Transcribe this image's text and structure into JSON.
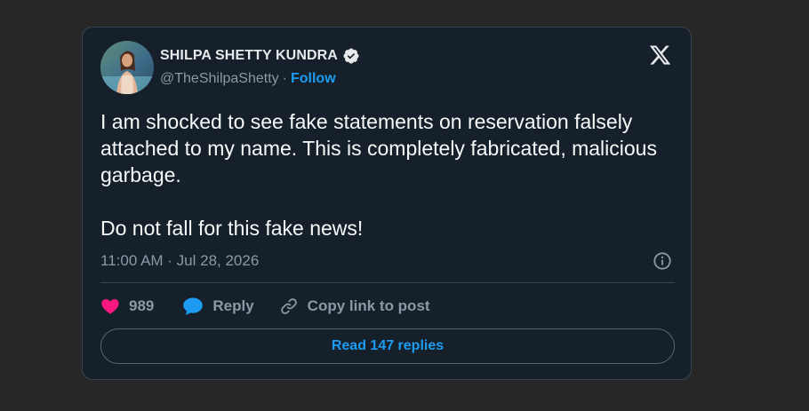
{
  "tweet": {
    "author_name": "SHILPA SHETTY KUNDRA",
    "handle": "@TheShilpaShetty",
    "separator": "·",
    "follow_label": "Follow",
    "paragraphs": [
      "I am shocked to see fake statements on reservation falsely attached to my name. This is completely fabricated, malicious garbage.",
      "Do not fall for this fake news!"
    ],
    "timestamp": "11:00 AM · Jul 28, 2026",
    "likes": "989",
    "reply_label": "Reply",
    "copy_link_label": "Copy link to post",
    "read_replies_label": "Read 147 replies"
  },
  "colors": {
    "page_background": "#272727",
    "card_background": "#15202b",
    "border": "#38444d",
    "text_primary": "#e7e9ea",
    "text_secondary": "#8b98a5",
    "accent_blue": "#1d9bf0",
    "like_pink": "#f91880",
    "verified_badge": "#e7e9ea"
  },
  "icons": [
    "x-logo-icon",
    "verified-badge-icon",
    "info-icon",
    "heart-icon",
    "reply-bubble-icon",
    "link-icon"
  ]
}
